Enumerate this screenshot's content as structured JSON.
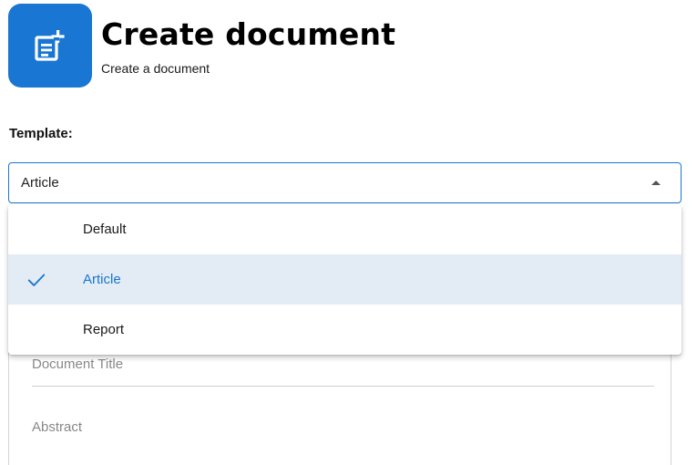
{
  "header": {
    "icon": "document-add-icon",
    "title": "Create document",
    "subtitle": "Create a document"
  },
  "template": {
    "label": "Template:",
    "selected_value": "Article",
    "options": [
      {
        "label": "Default",
        "selected": false
      },
      {
        "label": "Article",
        "selected": true
      },
      {
        "label": "Report",
        "selected": false
      }
    ]
  },
  "form": {
    "document_title_placeholder": "Document Title",
    "abstract_placeholder": "Abstract"
  },
  "colors": {
    "accent": "#1976d2",
    "selected_bg": "#e3ebf5"
  }
}
